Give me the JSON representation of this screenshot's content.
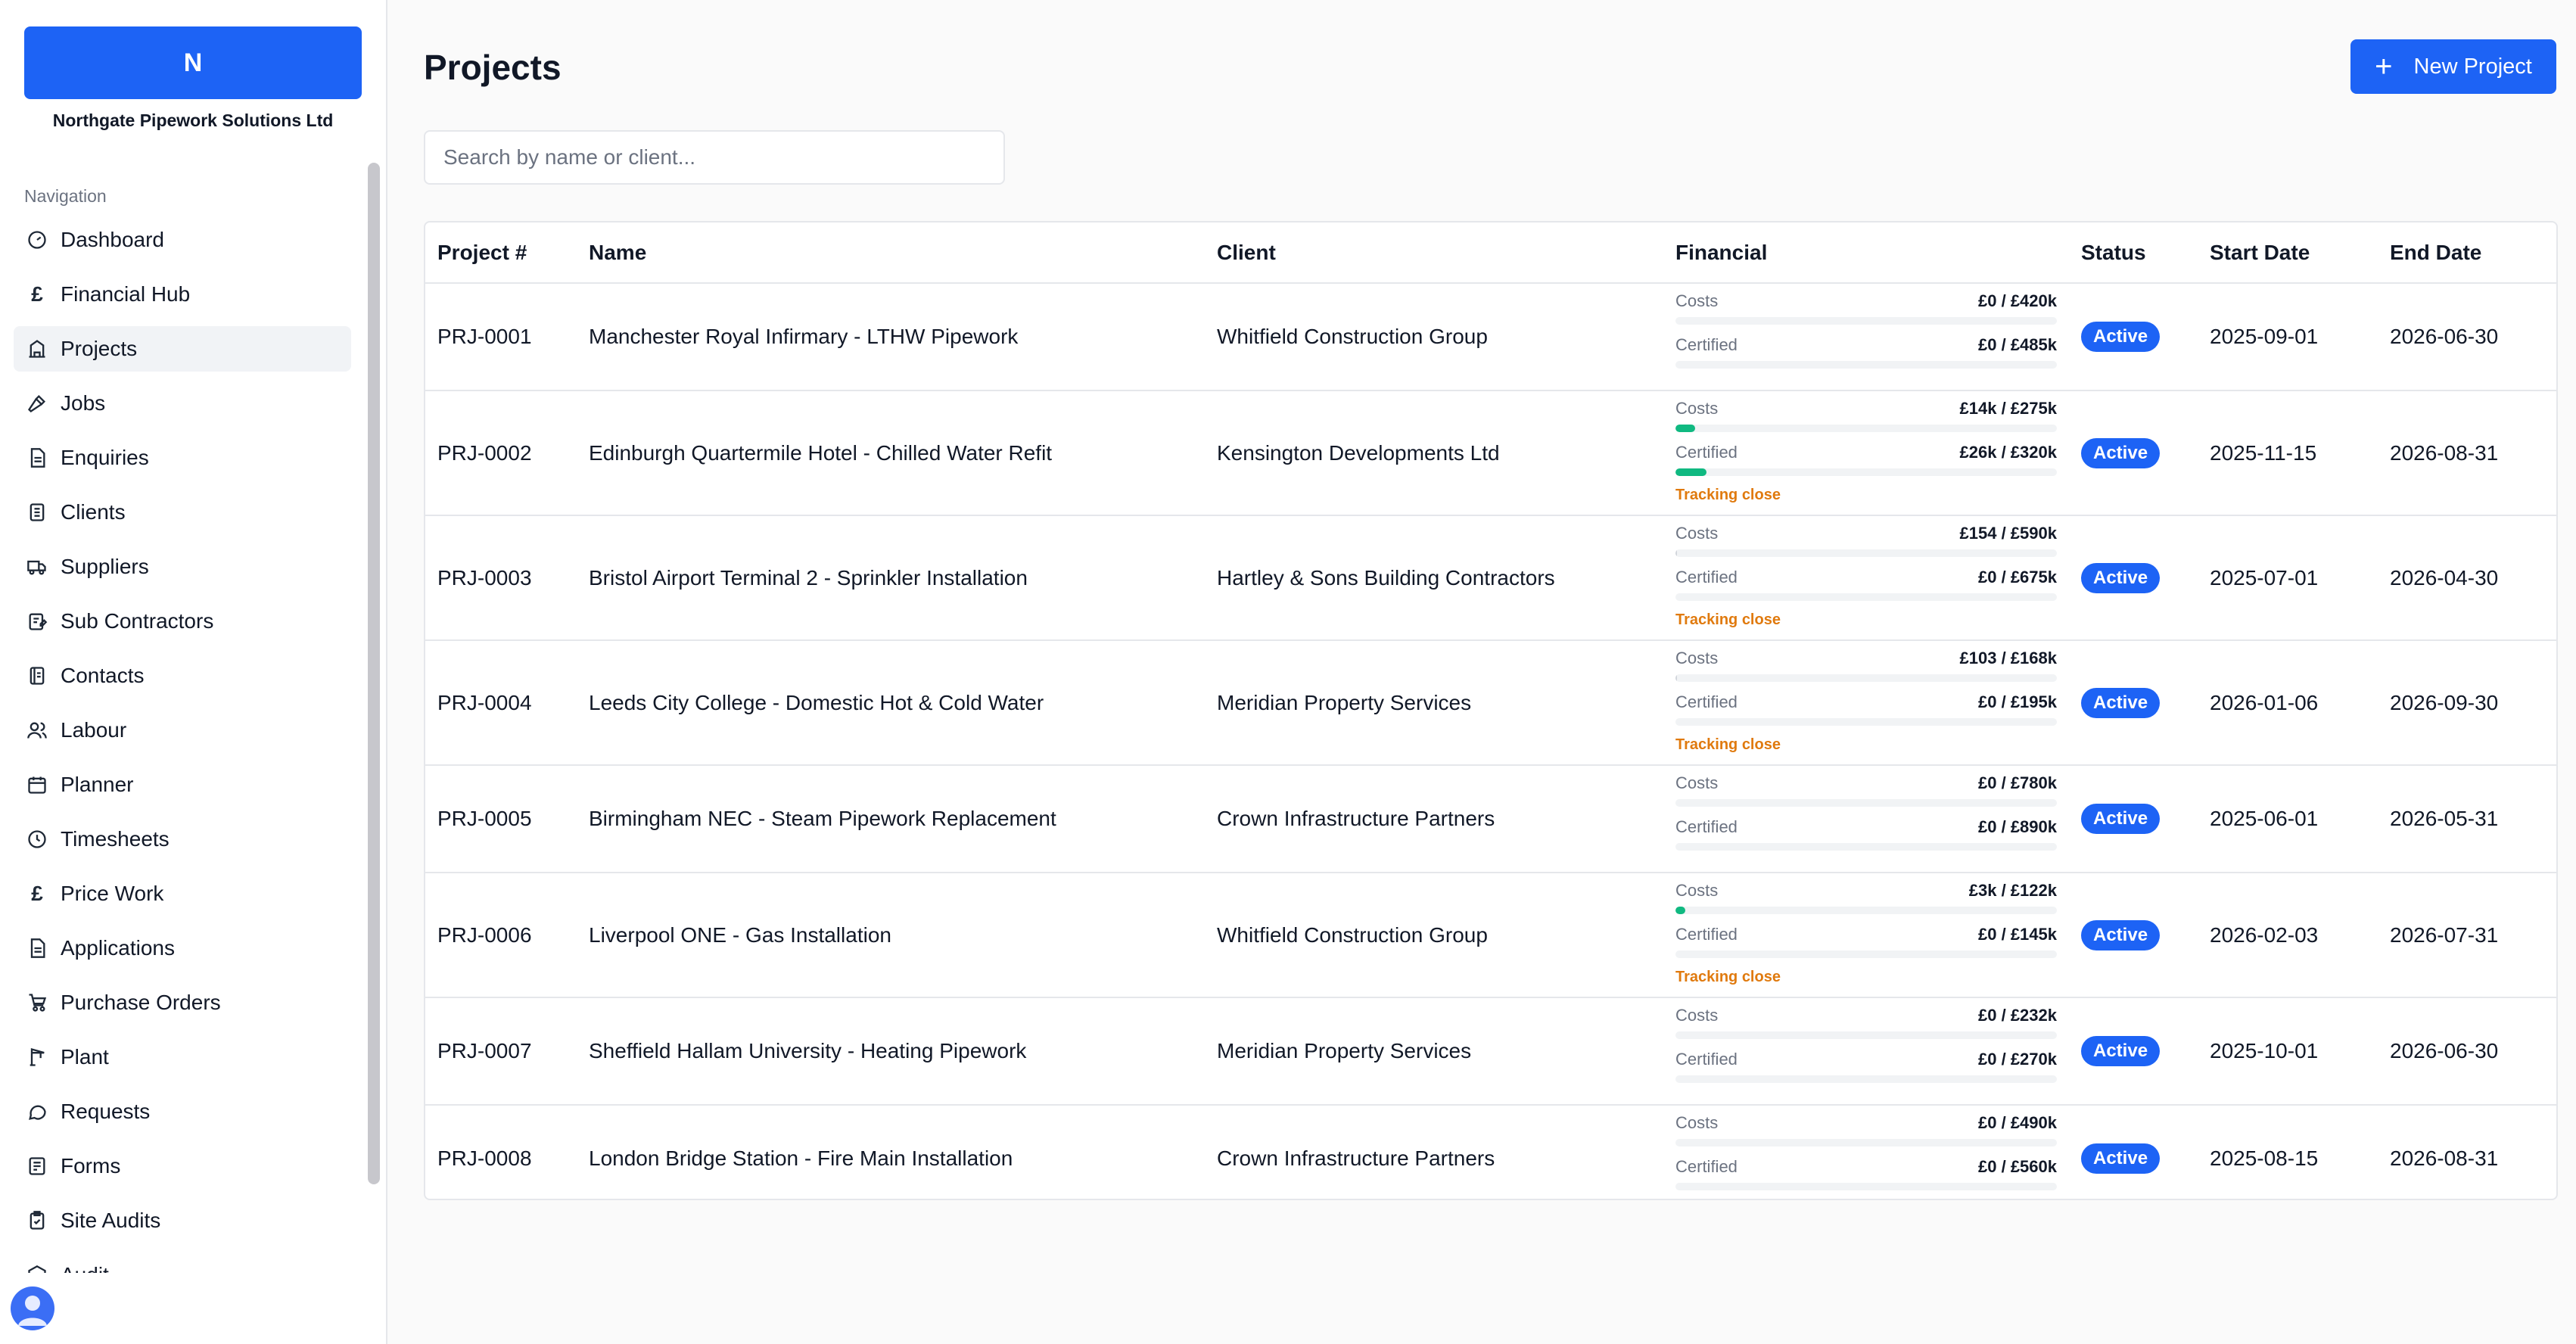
{
  "sidebar": {
    "brand_letter": "N",
    "company_name": "Northgate Pipework Solutions Ltd",
    "nav_heading": "Navigation",
    "items": [
      {
        "label": "Dashboard",
        "icon": "gauge-icon"
      },
      {
        "label": "Financial Hub",
        "icon": "pound-icon"
      },
      {
        "label": "Projects",
        "icon": "building-icon",
        "active": true
      },
      {
        "label": "Jobs",
        "icon": "hammer-icon"
      },
      {
        "label": "Enquiries",
        "icon": "document-icon"
      },
      {
        "label": "Clients",
        "icon": "contact-card-icon"
      },
      {
        "label": "Suppliers",
        "icon": "truck-icon"
      },
      {
        "label": "Sub Contractors",
        "icon": "clipboard-edit-icon"
      },
      {
        "label": "Contacts",
        "icon": "address-book-icon"
      },
      {
        "label": "Labour",
        "icon": "users-icon"
      },
      {
        "label": "Planner",
        "icon": "calendar-icon"
      },
      {
        "label": "Timesheets",
        "icon": "clock-icon"
      },
      {
        "label": "Price Work",
        "icon": "pound-icon"
      },
      {
        "label": "Applications",
        "icon": "document-icon"
      },
      {
        "label": "Purchase Orders",
        "icon": "cart-icon"
      },
      {
        "label": "Plant",
        "icon": "crane-icon"
      },
      {
        "label": "Requests",
        "icon": "chat-bubble-icon"
      },
      {
        "label": "Forms",
        "icon": "form-icon"
      },
      {
        "label": "Site Audits",
        "icon": "clipboard-check-icon"
      },
      {
        "label": "Audit",
        "icon": "cube-icon"
      }
    ]
  },
  "header": {
    "title": "Projects",
    "new_button_label": "New Project"
  },
  "search": {
    "placeholder": "Search by name or client..."
  },
  "table": {
    "columns": [
      "Project #",
      "Name",
      "Client",
      "Financial",
      "Status",
      "Start Date",
      "End Date"
    ],
    "costs_label": "Costs",
    "certified_label": "Certified",
    "rows": [
      {
        "id": "PRJ-0001",
        "name": "Manchester Royal Infirmary - LTHW Pipework",
        "client": "Whitfield Construction Group",
        "costs": "£0 / £420k",
        "costs_pct": 0,
        "certified": "£0 / £485k",
        "certified_pct": 0,
        "tracking": "",
        "status": "Active",
        "start": "2025-09-01",
        "end": "2026-06-30"
      },
      {
        "id": "PRJ-0002",
        "name": "Edinburgh Quartermile Hotel - Chilled Water Refit",
        "client": "Kensington Developments Ltd",
        "costs": "£14k / £275k",
        "costs_pct": 5.1,
        "certified": "£26k / £320k",
        "certified_pct": 8.1,
        "tracking": "Tracking close",
        "status": "Active",
        "start": "2025-11-15",
        "end": "2026-08-31"
      },
      {
        "id": "PRJ-0003",
        "name": "Bristol Airport Terminal 2 - Sprinkler Installation",
        "client": "Hartley & Sons Building Contractors",
        "costs": "£154 / £590k",
        "costs_pct": 0.03,
        "certified": "£0 / £675k",
        "certified_pct": 0,
        "tracking": "Tracking close",
        "status": "Active",
        "start": "2025-07-01",
        "end": "2026-04-30"
      },
      {
        "id": "PRJ-0004",
        "name": "Leeds City College - Domestic Hot & Cold Water",
        "client": "Meridian Property Services",
        "costs": "£103 / £168k",
        "costs_pct": 0.06,
        "certified": "£0 / £195k",
        "certified_pct": 0,
        "tracking": "Tracking close",
        "status": "Active",
        "start": "2026-01-06",
        "end": "2026-09-30"
      },
      {
        "id": "PRJ-0005",
        "name": "Birmingham NEC - Steam Pipework Replacement",
        "client": "Crown Infrastructure Partners",
        "costs": "£0 / £780k",
        "costs_pct": 0,
        "certified": "£0 / £890k",
        "certified_pct": 0,
        "tracking": "",
        "status": "Active",
        "start": "2025-06-01",
        "end": "2026-05-31"
      },
      {
        "id": "PRJ-0006",
        "name": "Liverpool ONE - Gas Installation",
        "client": "Whitfield Construction Group",
        "costs": "£3k / £122k",
        "costs_pct": 2.5,
        "certified": "£0 / £145k",
        "certified_pct": 0,
        "tracking": "Tracking close",
        "status": "Active",
        "start": "2026-02-03",
        "end": "2026-07-31"
      },
      {
        "id": "PRJ-0007",
        "name": "Sheffield Hallam University - Heating Pipework",
        "client": "Meridian Property Services",
        "costs": "£0 / £232k",
        "costs_pct": 0,
        "certified": "£0 / £270k",
        "certified_pct": 0,
        "tracking": "",
        "status": "Active",
        "start": "2025-10-01",
        "end": "2026-06-30"
      },
      {
        "id": "PRJ-0008",
        "name": "London Bridge Station - Fire Main Installation",
        "client": "Crown Infrastructure Partners",
        "costs": "£0 / £490k",
        "costs_pct": 0,
        "certified": "£0 / £560k",
        "certified_pct": 0,
        "tracking": "",
        "status": "Active",
        "start": "2025-08-15",
        "end": "2026-08-31"
      }
    ]
  },
  "colors": {
    "accent": "#1d63f5",
    "progress": "#10b981",
    "warning": "#e07a0e"
  }
}
